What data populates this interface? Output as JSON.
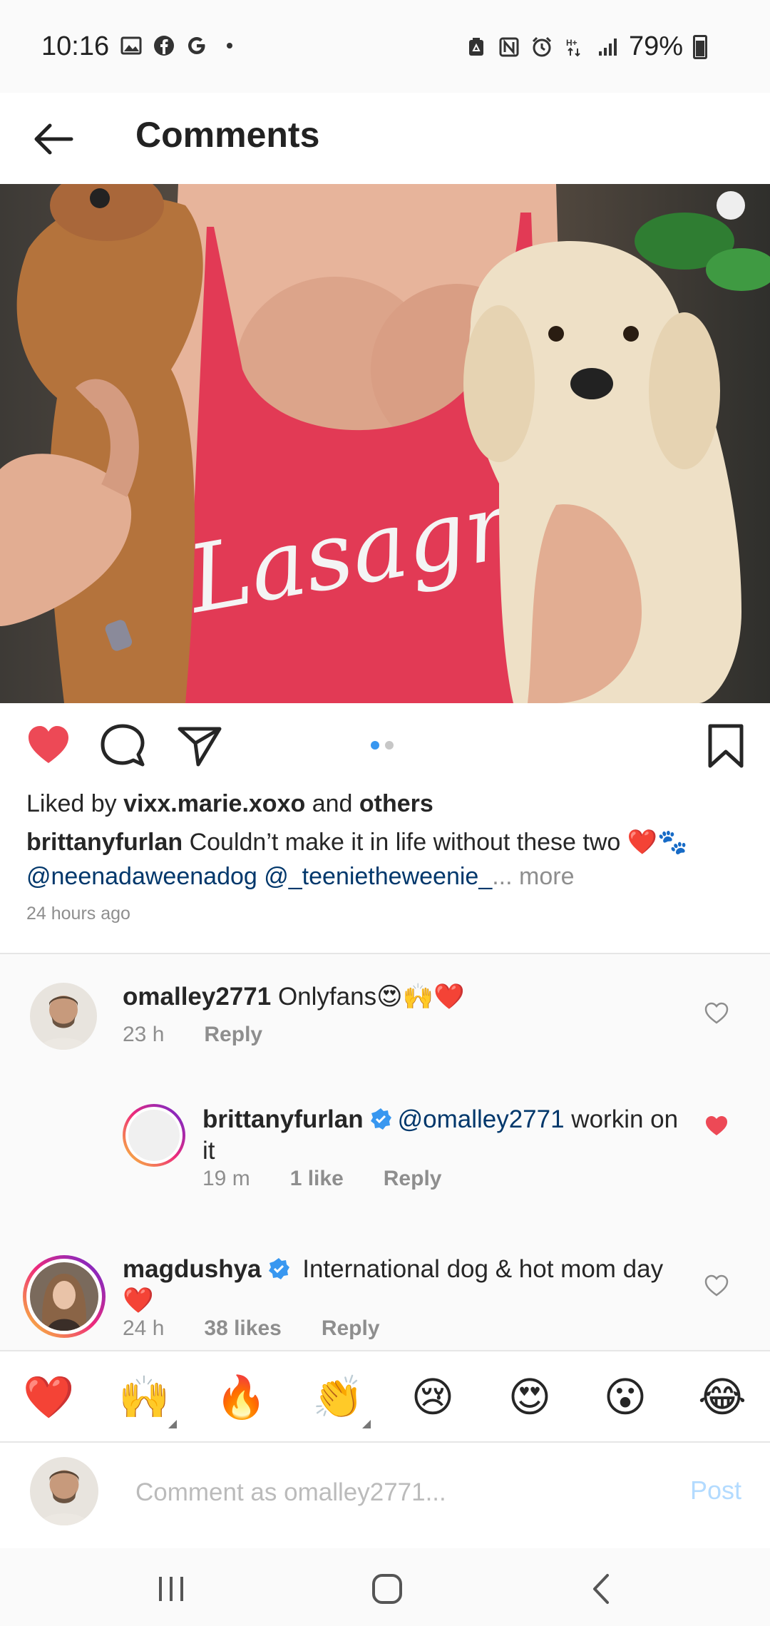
{
  "status_bar": {
    "time": "10:16",
    "battery": "79%",
    "left_icons": [
      "gallery-icon",
      "facebook-icon",
      "google-icon",
      "dot-icon"
    ],
    "right_icons": [
      "recycle-icon",
      "nfc-icon",
      "alarm-icon",
      "data-icon",
      "signal-icon",
      "battery-icon"
    ]
  },
  "header": {
    "title": "Comments"
  },
  "post": {
    "shirt_text": "Lasagne",
    "carousel": {
      "count": 2,
      "active": 0
    },
    "liked_prefix": "Liked by ",
    "liked_user": "vixx.marie.xoxo",
    "liked_and": " and ",
    "liked_others": "others",
    "caption_user": "brittanyfurlan",
    "caption_text": " Couldn’t make it in life without these two ❤️🐾",
    "mention_1": "@neenadaweenadog",
    "mention_2": "@_teenietheweenie_",
    "ellipsis": "...",
    "more": " more",
    "time_ago": "24 hours ago"
  },
  "comments": [
    {
      "user": "omalley2771",
      "text": " Onlyfans😍🙌❤️",
      "time": "23 h",
      "likes": "",
      "reply": "Reply",
      "liked": false
    },
    {
      "user": "brittanyfurlan",
      "verified": true,
      "mention": "@omalley2771",
      "text": " workin on it",
      "time": "19 m",
      "likes": "1 like",
      "reply": "Reply",
      "liked": true
    },
    {
      "user": "magdushya",
      "verified": true,
      "text": "International dog & hot mom day ❤️",
      "time": "24 h",
      "likes": "38 likes",
      "reply": "Reply",
      "liked": false
    }
  ],
  "emoji_bar": [
    "❤️",
    "🙌",
    "🔥",
    "👏",
    "😢",
    "😍",
    "😮",
    "😂"
  ],
  "input": {
    "placeholder": "Comment as omalley2771...",
    "post_label": "Post"
  },
  "colors": {
    "like_red": "#ed4956",
    "link_blue": "#00376b",
    "verified_blue": "#3897f0",
    "post_disabled": "#b3dbff"
  }
}
